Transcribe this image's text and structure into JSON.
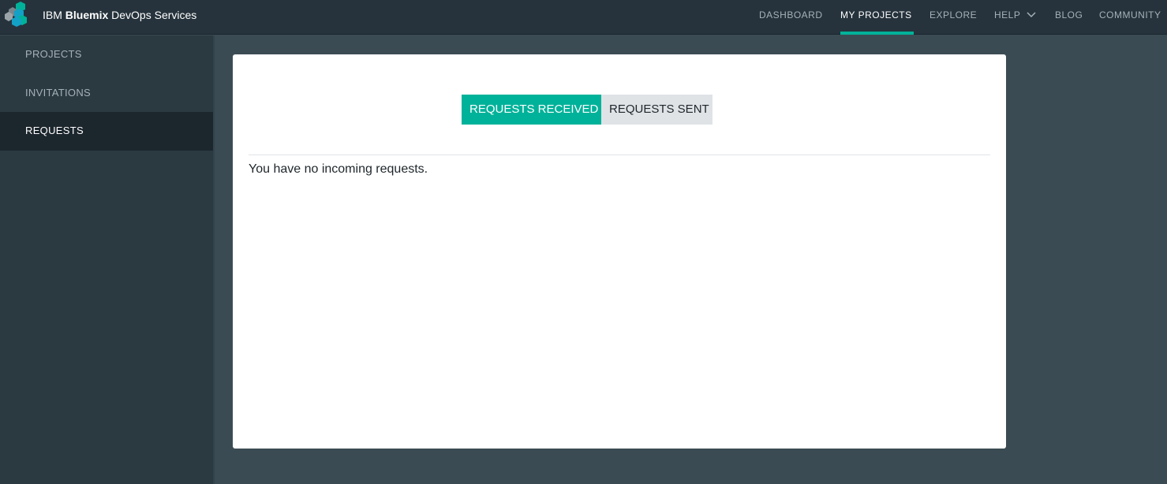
{
  "header": {
    "brand_prefix": "IBM ",
    "brand_bold": "Bluemix",
    "brand_suffix": " DevOps Services",
    "logo_icon": "bluemix-hexagon-logo-icon",
    "nav": [
      {
        "label": "DASHBOARD",
        "active": false
      },
      {
        "label": "MY PROJECTS",
        "active": true
      },
      {
        "label": "EXPLORE",
        "active": false
      },
      {
        "label": "HELP",
        "active": false,
        "icon": "chevron-down-icon"
      },
      {
        "label": "BLOG",
        "active": false
      },
      {
        "label": "COMMUNITY",
        "active": false
      }
    ]
  },
  "sidebar": {
    "items": [
      {
        "label": "PROJECTS",
        "active": false
      },
      {
        "label": "INVITATIONS",
        "active": false
      },
      {
        "label": "REQUESTS",
        "active": true
      }
    ]
  },
  "main": {
    "tabs": [
      {
        "label": "REQUESTS RECEIVED",
        "active": true
      },
      {
        "label": "REQUESTS SENT",
        "active": false
      }
    ],
    "empty_message": "You have no incoming requests."
  },
  "colors": {
    "accent": "#00b299",
    "topbar_bg": "#26333c",
    "sidebar_bg": "#2b3940",
    "content_bg": "#3b4b54"
  }
}
